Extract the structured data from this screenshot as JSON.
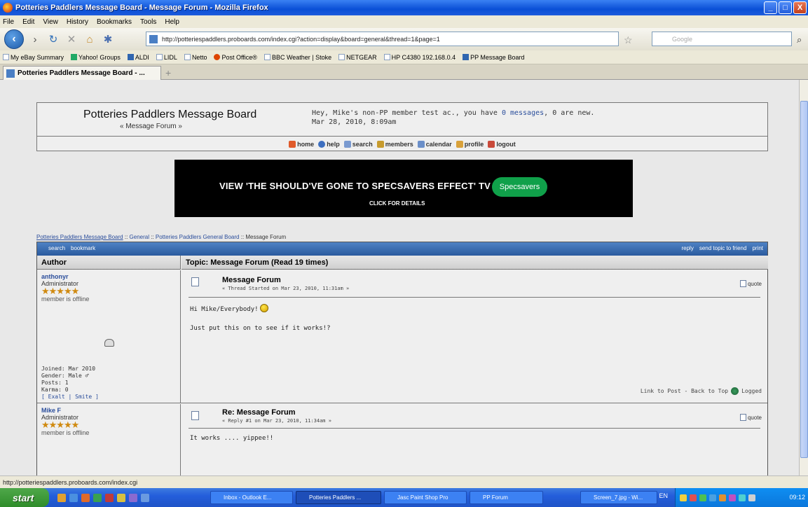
{
  "window": {
    "title": "Potteries Paddlers Message Board - Message Forum - Mozilla Firefox",
    "buttons": {
      "minimize": "_",
      "maximize": "□",
      "close": "X"
    }
  },
  "menu": [
    "File",
    "Edit",
    "View",
    "History",
    "Bookmarks",
    "Tools",
    "Help"
  ],
  "nav": {
    "url": "http://potteriespaddlers.proboards.com/index.cgi?action=display&board=general&thread=1&page=1",
    "search_placeholder": "Google"
  },
  "bookmarks": [
    "My eBay Summary",
    "Yahoo! Groups",
    "ALDI",
    "LIDL",
    "Netto",
    "Post Office®",
    "BBC Weather | Stoke",
    "NETGEAR",
    "HP C4380 192.168.0.4",
    "PP Message Board"
  ],
  "tab": {
    "title": "Potteries Paddlers Message Board - ..."
  },
  "board": {
    "title": "Potteries Paddlers Message Board",
    "subtitle": "« Message Forum »",
    "greeting_prefix": "Hey, Mike's non-PP member test ac., you have ",
    "greeting_link": "0 messages",
    "greeting_suffix": ", 0 are new.",
    "date": "Mar 28, 2010, 8:09am",
    "nav_items": [
      "home",
      "help",
      "search",
      "members",
      "calendar",
      "profile",
      "logout"
    ]
  },
  "ad": {
    "headline": "VIEW 'THE SHOULD'VE GONE TO SPECSAVERS EFFECT' TV AD",
    "cta": "CLICK FOR DETAILS",
    "brand": "Specsavers"
  },
  "breadcrumb": [
    "Potteries Paddlers Message Board",
    "General",
    "Potteries Paddlers General Board",
    "Message Forum"
  ],
  "thread_toolbar": {
    "left": [
      "search",
      "bookmark"
    ],
    "right": [
      "reply",
      "send topic to friend",
      "print"
    ]
  },
  "columns": {
    "author": "Author",
    "topic": "Topic: Message Forum  (Read 19 times)"
  },
  "posts": [
    {
      "author": "anthonyr",
      "role": "Administrator",
      "stars": "★★★★★",
      "status": "member is offline",
      "joined": "Joined: Mar 2010",
      "gender": "Gender: Male ♂",
      "posts": "Posts: 1",
      "karma": "Karma: 0",
      "karma_links": "[ Exalt | Smite ]",
      "title": "Message Forum",
      "meta": "« Thread Started on Mar 23, 2010, 11:31am »",
      "quote": "quote",
      "body_line1": "Hi Mike/Everybody!",
      "body_line2": "Just put this on to see if it works!?",
      "footer_link": "Link to Post - Back to Top",
      "footer_logged": "Logged"
    },
    {
      "author": "Mike F",
      "role": "Administrator",
      "stars": "★★★★★",
      "status": "member is offline",
      "title": "Re: Message Forum",
      "meta": "« Reply #1 on Mar 23, 2010, 11:34am »",
      "quote": "quote",
      "body_line1": "It works .... yippee!!"
    }
  ],
  "statusbar": "http://potteriespaddlers.proboards.com/index.cgi",
  "taskbar": {
    "start": "start",
    "items": [
      "Inbox - Outlook E...",
      "Potteries Paddlers ...",
      "Jasc Paint Shop Pro",
      "PP Forum",
      "Screen_7.jpg - Wi..."
    ],
    "lang": "EN",
    "clock": "09:12"
  }
}
